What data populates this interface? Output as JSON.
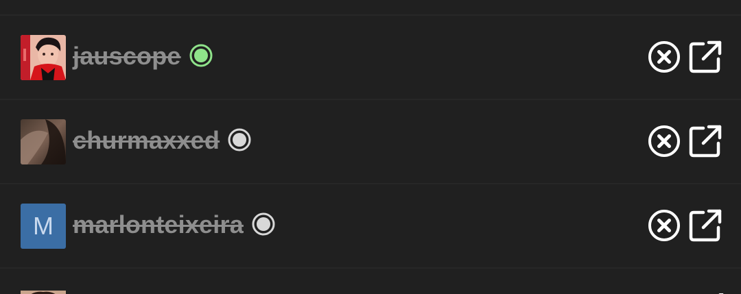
{
  "colors": {
    "background": "#202020",
    "divider": "#272727",
    "username": "#8e8e8e",
    "online": "#8fe38a",
    "offline": "#d8d8d8",
    "icon": "#ffffff",
    "letter_avatar_bg": "#3b6ea5"
  },
  "users": [
    {
      "username": "jauscope",
      "status": "online",
      "status_icon": "status-online-icon",
      "avatar": "photo"
    },
    {
      "username": "churmaxxed",
      "status": "offline",
      "status_icon": "status-offline-icon",
      "avatar": "photo"
    },
    {
      "username": "marlonteixeira",
      "status": "offline",
      "status_icon": "status-offline-icon",
      "avatar": "letter",
      "avatar_letter": "M"
    }
  ],
  "actions": {
    "remove_icon": "close-circle-icon",
    "open_icon": "external-link-icon"
  }
}
